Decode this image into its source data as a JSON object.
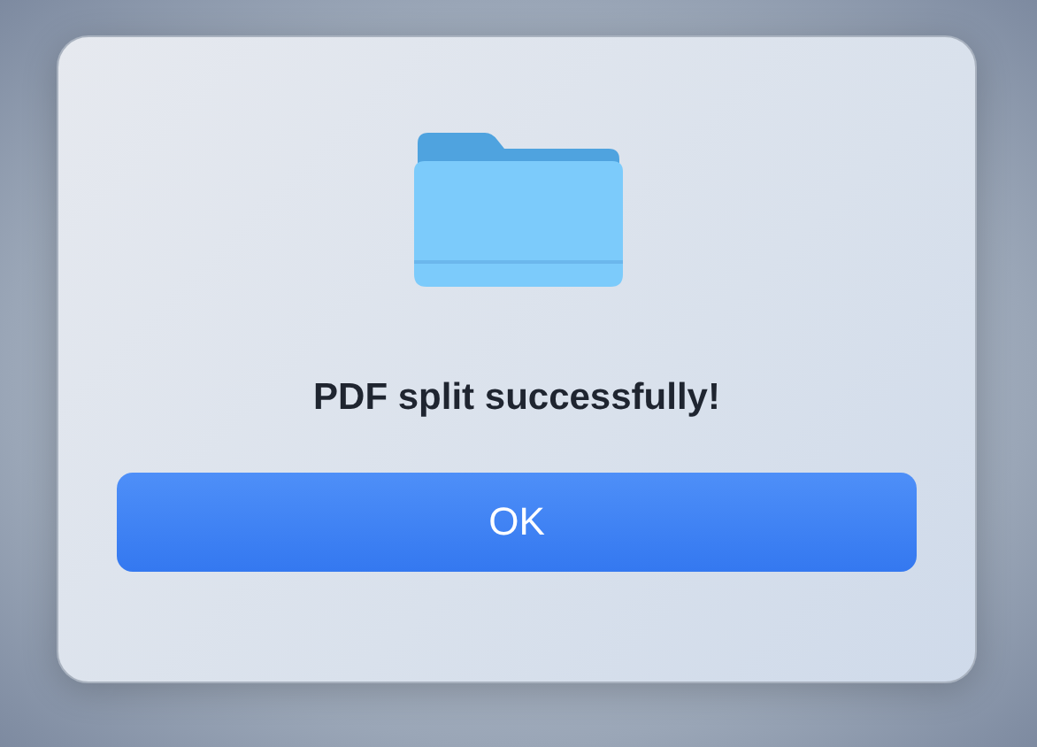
{
  "dialog": {
    "message": "PDF split successfully!",
    "buttons": [
      "OK"
    ]
  }
}
